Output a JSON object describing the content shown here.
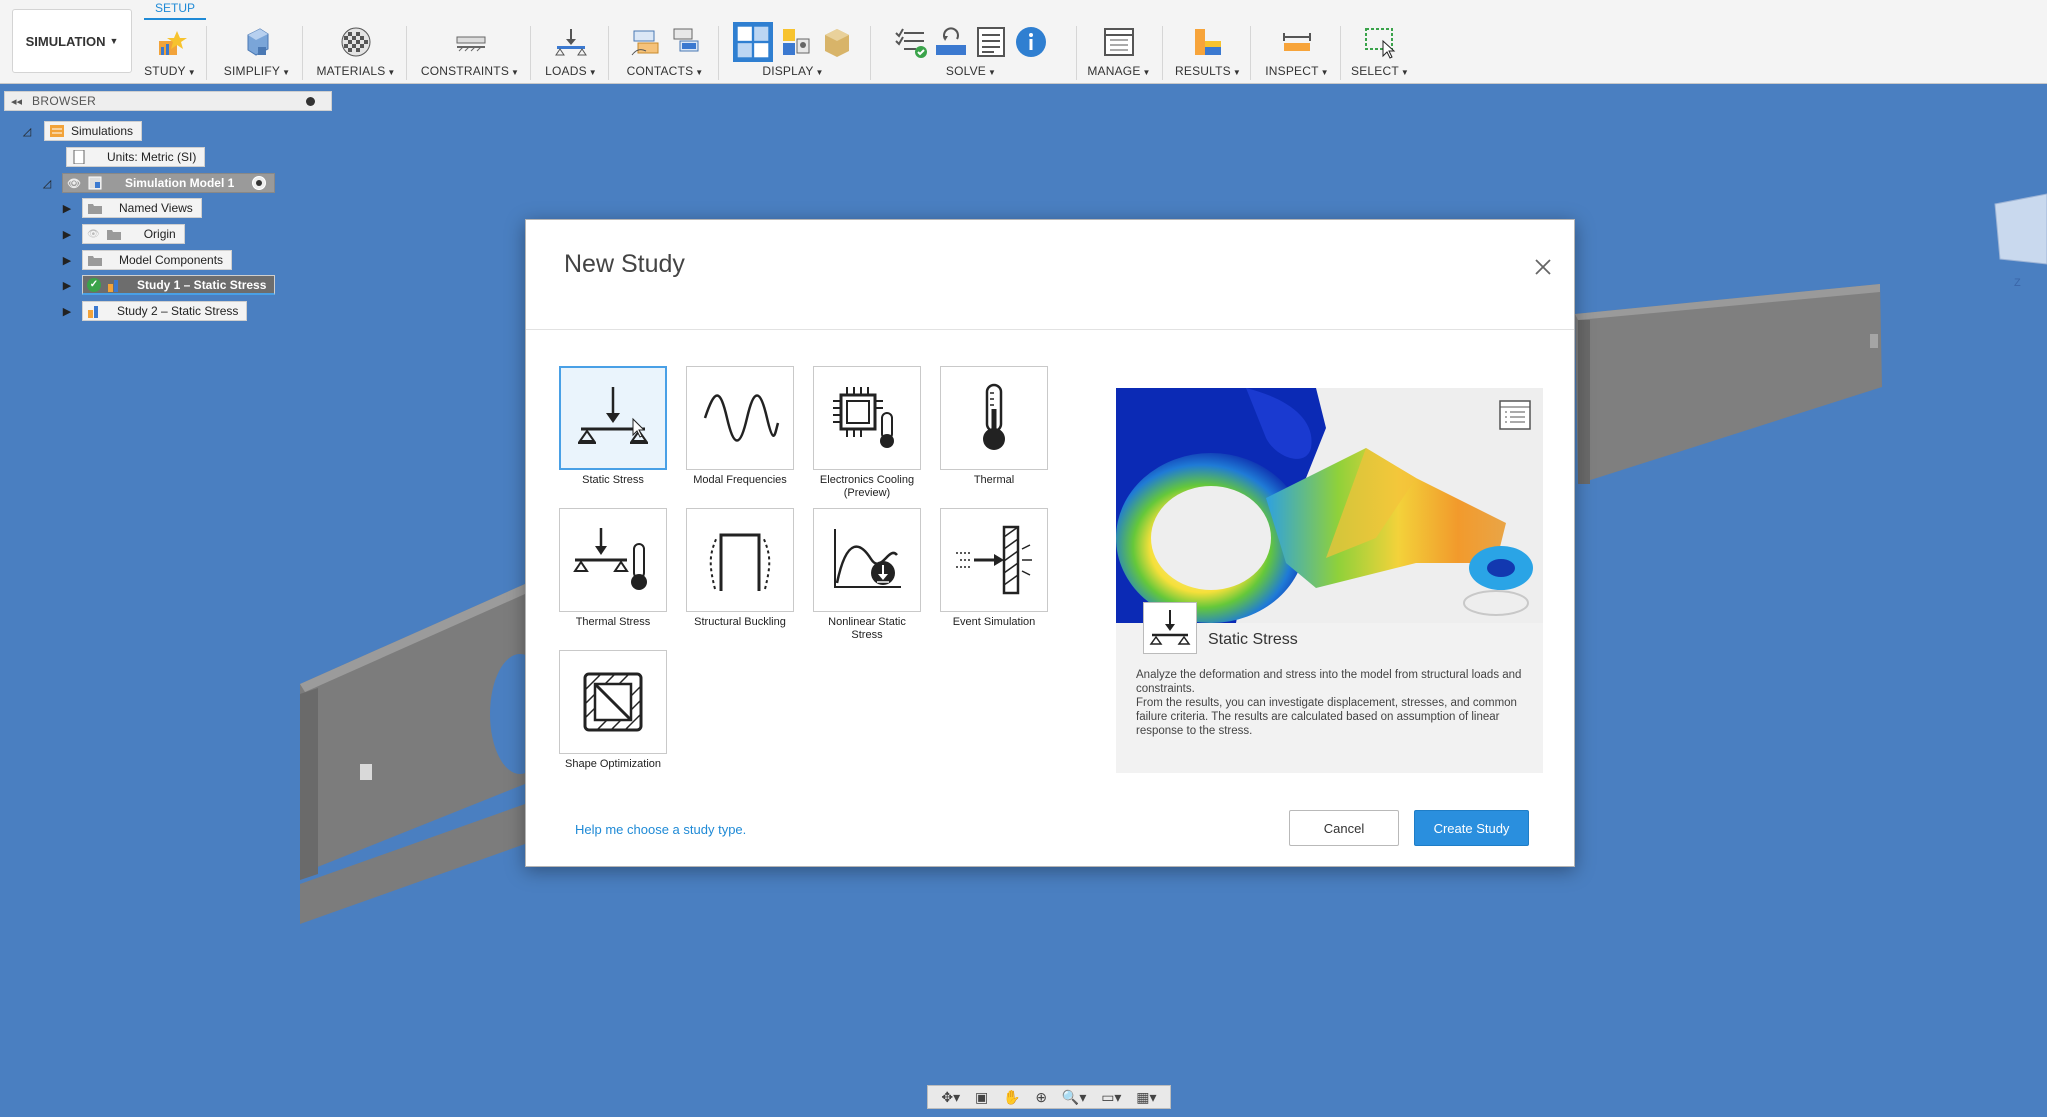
{
  "toolbar": {
    "workspace": "SIMULATION",
    "active_tab": "SETUP",
    "groups": [
      {
        "label": "STUDY"
      },
      {
        "label": "SIMPLIFY"
      },
      {
        "label": "MATERIALS"
      },
      {
        "label": "CONSTRAINTS"
      },
      {
        "label": "LOADS"
      },
      {
        "label": "CONTACTS"
      },
      {
        "label": "DISPLAY"
      },
      {
        "label": "SOLVE"
      },
      {
        "label": "MANAGE"
      },
      {
        "label": "RESULTS"
      },
      {
        "label": "INSPECT"
      },
      {
        "label": "SELECT"
      }
    ]
  },
  "browser": {
    "title": "BROWSER",
    "tree": [
      {
        "label": "Simulations"
      },
      {
        "label": "Units: Metric (SI)"
      },
      {
        "label": "Simulation Model 1"
      },
      {
        "label": "Named Views"
      },
      {
        "label": "Origin"
      },
      {
        "label": "Model Components"
      },
      {
        "label": "Study 1 – Static Stress"
      },
      {
        "label": "Study 2 – Static Stress"
      }
    ]
  },
  "dialog": {
    "title": "New Study",
    "study_types": [
      {
        "label": "Static Stress",
        "selected": true
      },
      {
        "label": "Modal Frequencies"
      },
      {
        "label": "Electronics Cooling",
        "sub": "(Preview)"
      },
      {
        "label": "Thermal"
      },
      {
        "label": "Thermal Stress"
      },
      {
        "label": "Structural Buckling"
      },
      {
        "label": "Nonlinear Static",
        "sub": "Stress"
      },
      {
        "label": "Event Simulation"
      },
      {
        "label": "Shape Optimization"
      }
    ],
    "preview": {
      "name": "Static Stress",
      "description_1": "Analyze the deformation and stress into the model from structural loads and constraints.",
      "description_2": "From the results, you can investigate displacement, stresses, and common failure criteria. The results are calculated based on assumption of linear response to the stress."
    },
    "help_link": "Help me choose a study type.",
    "cancel_label": "Cancel",
    "create_label": "Create Study"
  },
  "colors": {
    "viewport_bg": "#4a7fc1",
    "accent": "#2a8fde"
  }
}
